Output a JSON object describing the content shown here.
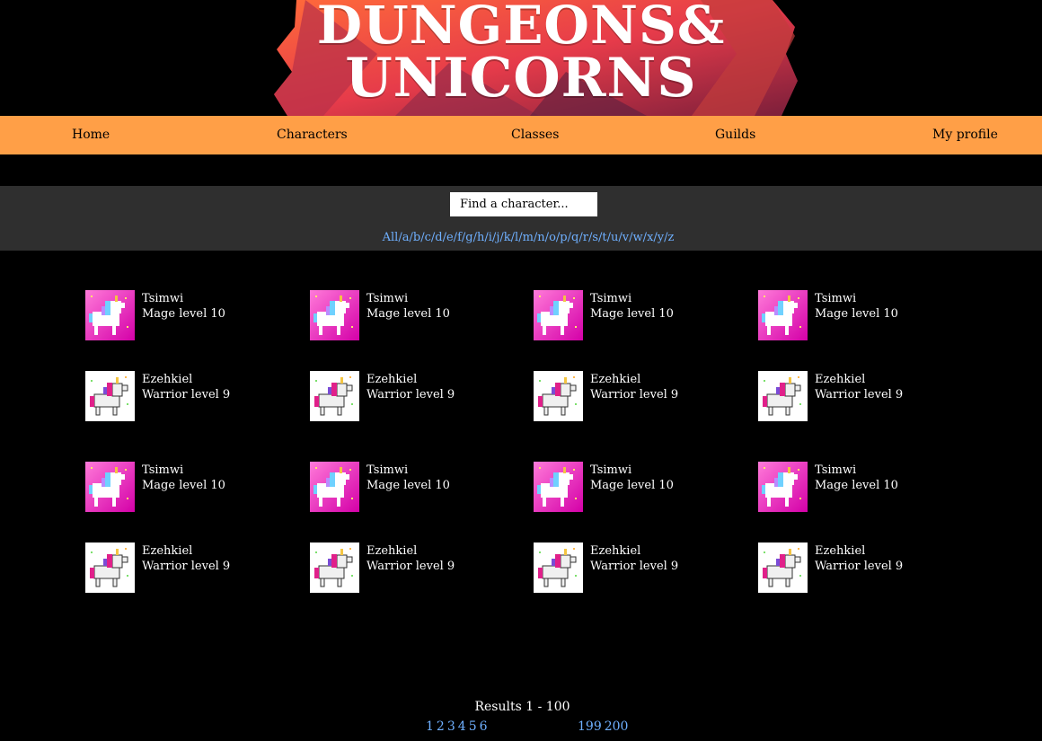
{
  "banner": {
    "line1": "DUNGEONS&",
    "line2": "UNICORNS"
  },
  "nav": {
    "items": [
      "Home",
      "Characters",
      "Classes",
      "Guilds",
      "My profile"
    ]
  },
  "search": {
    "placeholder": "Find a character...",
    "letters": [
      "All",
      "a",
      "b",
      "c",
      "d",
      "e",
      "f",
      "g",
      "h",
      "i",
      "j",
      "k",
      "l",
      "m",
      "n",
      "o",
      "p",
      "q",
      "r",
      "s",
      "t",
      "u",
      "v",
      "w",
      "x",
      "y",
      "z"
    ]
  },
  "characters": [
    {
      "name": "Tsimwi",
      "desc": "Mage level 10",
      "avatar": "unicorn-pink-icon"
    },
    {
      "name": "Tsimwi",
      "desc": "Mage level 10",
      "avatar": "unicorn-pink-icon"
    },
    {
      "name": "Tsimwi",
      "desc": "Mage level 10",
      "avatar": "unicorn-pink-icon"
    },
    {
      "name": "Tsimwi",
      "desc": "Mage level 10",
      "avatar": "unicorn-pink-icon"
    },
    {
      "name": "Ezehkiel",
      "desc": "Warrior level 9",
      "avatar": "unicorn-white-icon"
    },
    {
      "name": "Ezehkiel",
      "desc": "Warrior level 9",
      "avatar": "unicorn-white-icon"
    },
    {
      "name": "Ezehkiel",
      "desc": "Warrior level 9",
      "avatar": "unicorn-white-icon"
    },
    {
      "name": "Ezehkiel",
      "desc": "Warrior level 9",
      "avatar": "unicorn-white-icon"
    },
    {
      "name": "Tsimwi",
      "desc": "Mage level 10",
      "avatar": "unicorn-pink-icon"
    },
    {
      "name": "Tsimwi",
      "desc": "Mage level 10",
      "avatar": "unicorn-pink-icon"
    },
    {
      "name": "Tsimwi",
      "desc": "Mage level 10",
      "avatar": "unicorn-pink-icon"
    },
    {
      "name": "Tsimwi",
      "desc": "Mage level 10",
      "avatar": "unicorn-pink-icon"
    },
    {
      "name": "Ezehkiel",
      "desc": "Warrior level 9",
      "avatar": "unicorn-white-icon"
    },
    {
      "name": "Ezehkiel",
      "desc": "Warrior level 9",
      "avatar": "unicorn-white-icon"
    },
    {
      "name": "Ezehkiel",
      "desc": "Warrior level 9",
      "avatar": "unicorn-white-icon"
    },
    {
      "name": "Ezehkiel",
      "desc": "Warrior level 9",
      "avatar": "unicorn-white-icon"
    }
  ],
  "results": {
    "text": "Results 1 - 100",
    "pages_start": [
      "1",
      "2",
      "3",
      "4",
      "5",
      "6"
    ],
    "pages_end": [
      "199",
      "200"
    ]
  },
  "colors": {
    "nav_bg": "#ff9f47",
    "search_band_bg": "#2f2f2f",
    "link": "#6fb0ff"
  }
}
